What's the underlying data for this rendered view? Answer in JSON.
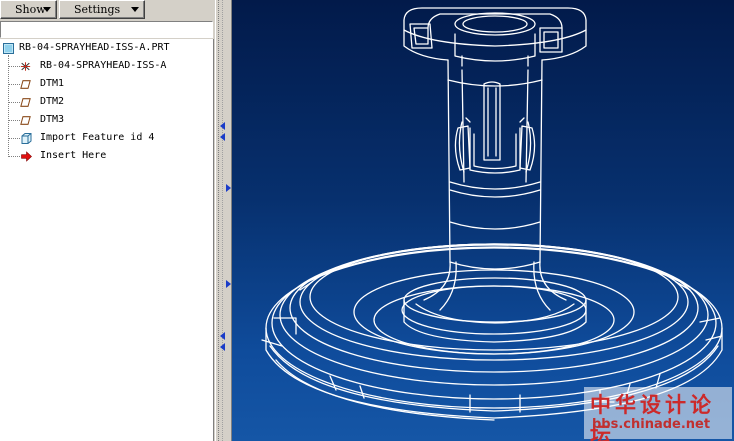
{
  "toolbar": {
    "show_label": "Show",
    "settings_label": "Settings"
  },
  "model_tree": {
    "root": {
      "label": "RB-04-SPRAYHEAD-ISS-A.PRT",
      "icon": "part-icon"
    },
    "items": [
      {
        "label": "RB-04-SPRAYHEAD-ISS-A",
        "icon": "coordinate-system-icon"
      },
      {
        "label": "DTM1",
        "icon": "datum-plane-icon"
      },
      {
        "label": "DTM2",
        "icon": "datum-plane-icon"
      },
      {
        "label": "DTM3",
        "icon": "datum-plane-icon"
      },
      {
        "label": "Import Feature id 4",
        "icon": "import-feature-icon"
      },
      {
        "label": "Insert Here",
        "icon": "insert-here-arrow-icon"
      }
    ]
  },
  "viewport": {
    "background_top": "#021a4a",
    "background_bottom": "#1556a6",
    "wireframe_color": "#ffffff"
  },
  "watermark": {
    "chinese_text": "中华设计论坛",
    "url": "bbs.chinade.net"
  }
}
